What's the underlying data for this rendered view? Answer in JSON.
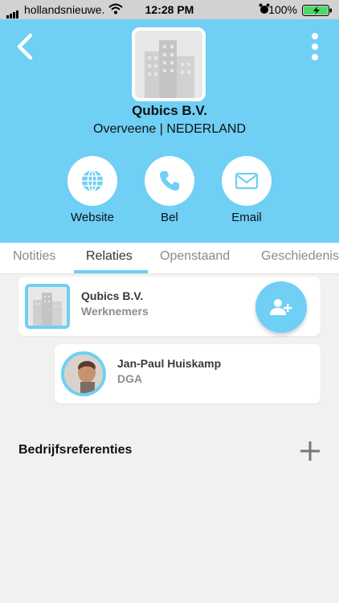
{
  "status_bar": {
    "carrier": "hollandsnieuwe.",
    "time": "12:28 PM",
    "battery": "100%"
  },
  "header": {
    "company_name": "Qubics B.V.",
    "location": "Overveene | NEDERLAND",
    "actions": [
      {
        "label": "Website",
        "icon": "globe-icon"
      },
      {
        "label": "Bel",
        "icon": "phone-icon"
      },
      {
        "label": "Email",
        "icon": "mail-icon"
      }
    ]
  },
  "tabs": [
    {
      "label": "Notities",
      "active": false
    },
    {
      "label": "Relaties",
      "active": true
    },
    {
      "label": "Openstaand",
      "active": false
    },
    {
      "label": "Geschiedenis",
      "active": false
    }
  ],
  "relations": [
    {
      "title": "Qubics B.V.",
      "subtitle": "Werknemers"
    },
    {
      "title": "Jan-Paul Huiskamp",
      "subtitle": "DGA"
    }
  ],
  "section": {
    "title": "Bedrijfsreferenties"
  },
  "colors": {
    "accent": "#6fcff5",
    "background": "#f1f1f1"
  }
}
